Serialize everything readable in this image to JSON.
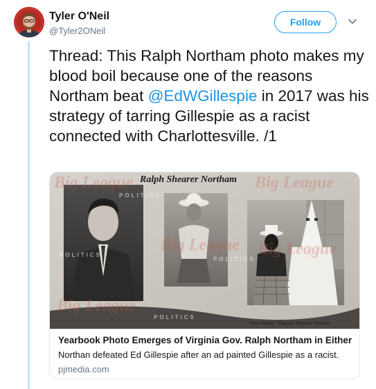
{
  "author": {
    "name": "Tyler O'Neil",
    "handle": "@Tyler2ONeil"
  },
  "follow_button": {
    "label": "Follow"
  },
  "icons": {
    "more": "chevron-down-icon",
    "avatar": "avatar"
  },
  "tweet": {
    "text_before": "Thread: This Ralph Northam photo makes my blood boil because one of the reasons Northam beat ",
    "mention": "@EdWGillespie",
    "text_after": " in 2017 was his strategy of tarring Gillespie as a racist connected with Charlottesville. /1"
  },
  "card": {
    "image": {
      "heading": "Ralph Shearer Northam",
      "caption": "Alma Mater: Virginia Military Institute",
      "watermark": "Big League",
      "watermark_sub": "POLITICS"
    },
    "title": "Yearbook Photo Emerges of Virginia Gov. Ralph Northam in Either Bl...",
    "description": "Northan defeated Ed Gillespie after an ad painted Gillespie as a racist.",
    "domain": "pjmedia.com"
  },
  "colors": {
    "accent": "#1da1f2",
    "mention": "#1b95e0",
    "text": "#14171a",
    "secondary": "#657786",
    "thread_line": "#c4e3f7",
    "card_border": "#e1e8ed"
  }
}
